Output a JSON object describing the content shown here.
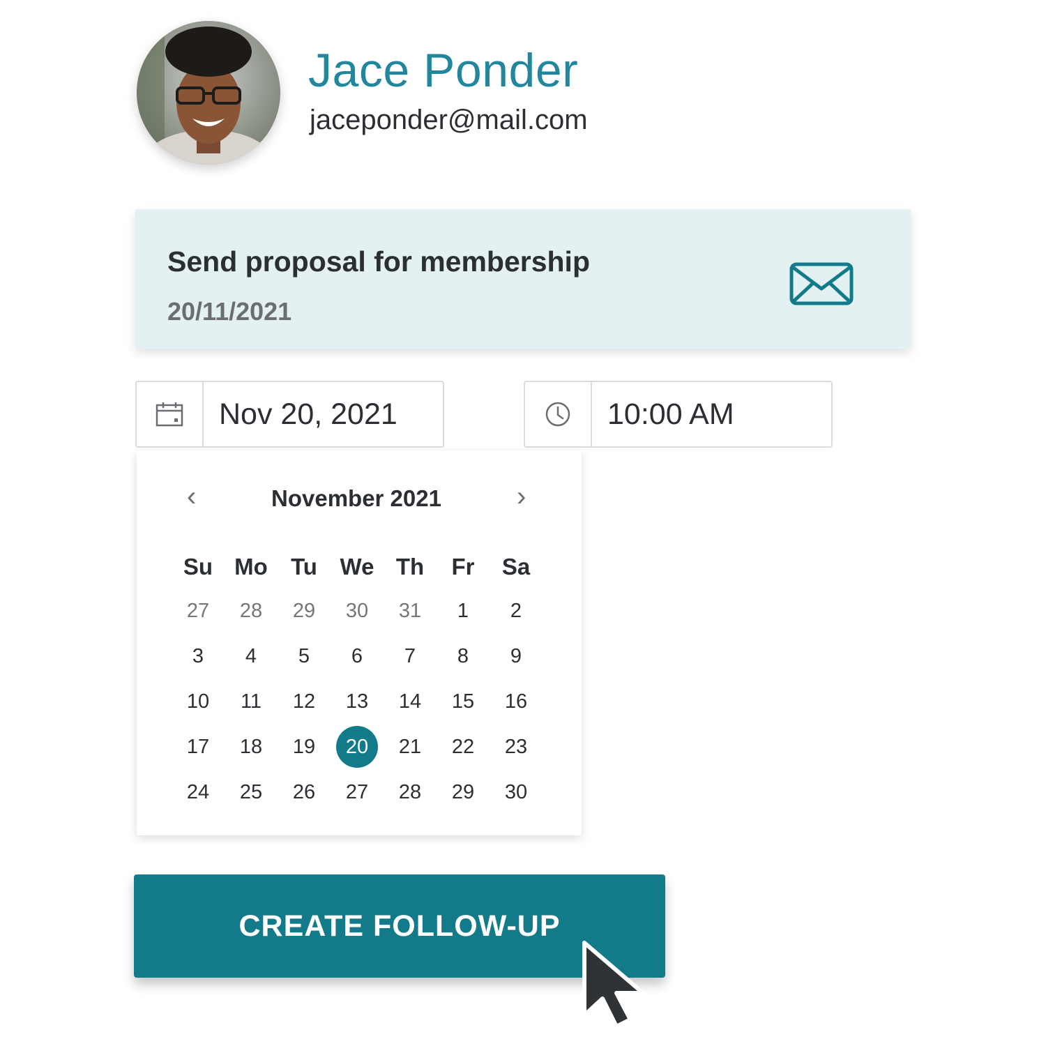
{
  "contact": {
    "name": "Jace Ponder",
    "email": "jaceponder@mail.com",
    "avatar_icon": "profile-photo"
  },
  "task": {
    "title": "Send proposal for membership",
    "date": "20/11/2021",
    "icon": "envelope-icon"
  },
  "date_input": {
    "value": "Nov 20, 2021",
    "icon": "calendar-icon"
  },
  "time_input": {
    "value": "10:00 AM",
    "icon": "clock-icon"
  },
  "calendar": {
    "month_label": "November 2021",
    "prev_label": "‹",
    "next_label": "›",
    "weekdays": [
      "Su",
      "Mo",
      "Tu",
      "We",
      "Th",
      "Fr",
      "Sa"
    ],
    "weeks": [
      [
        "27",
        "28",
        "29",
        "30",
        "31",
        "1",
        "2"
      ],
      [
        "3",
        "4",
        "5",
        "6",
        "7",
        "8",
        "9"
      ],
      [
        "10",
        "11",
        "12",
        "13",
        "14",
        "15",
        "16"
      ],
      [
        "17",
        "18",
        "19",
        "20",
        "21",
        "22",
        "23"
      ],
      [
        "24",
        "25",
        "26",
        "27",
        "28",
        "29",
        "30"
      ]
    ],
    "muted_days": [
      "27",
      "28",
      "29",
      "30",
      "31"
    ],
    "selected_day": "20"
  },
  "action": {
    "create_label": "CREATE FOLLOW-UP"
  },
  "colors": {
    "accent": "#137a8a",
    "name_teal": "#22879d",
    "card_bg": "#e4f1f3"
  }
}
